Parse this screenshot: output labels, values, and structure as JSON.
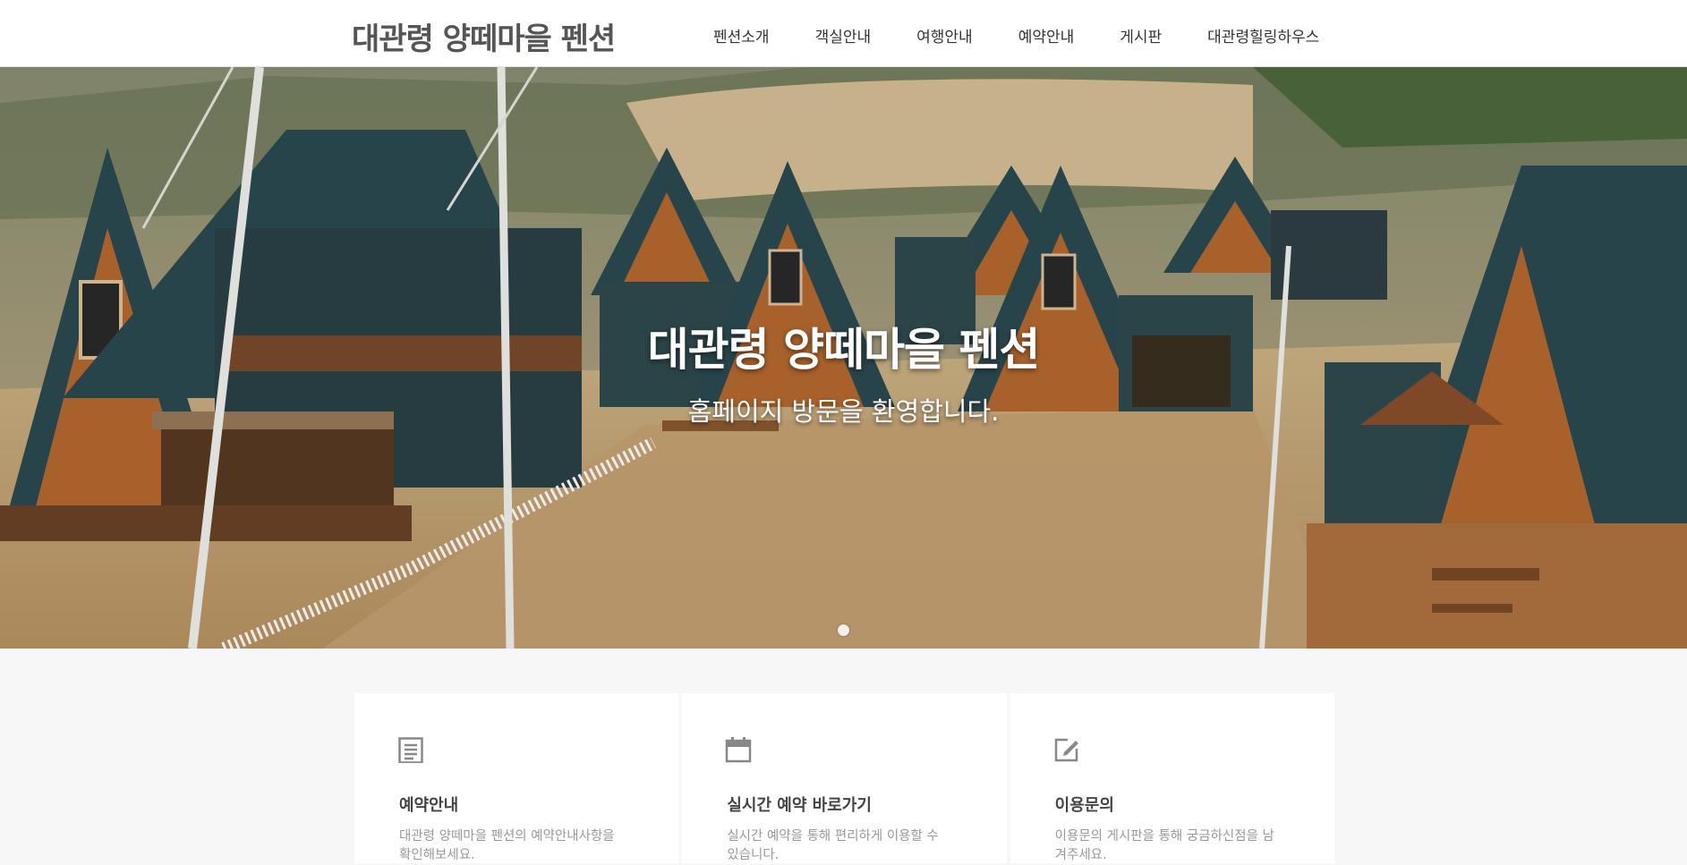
{
  "header": {
    "logo": "대관령 양떼마을 펜션",
    "nav": [
      "펜션소개",
      "객실안내",
      "여행안내",
      "예약안내",
      "게시판",
      "대관령힐링하우스"
    ]
  },
  "hero": {
    "title": "대관령 양떼마을 펜션",
    "subtitle": "홈페이지 방문을 환영합니다."
  },
  "cards": [
    {
      "icon": "document-icon",
      "title": "예약안내",
      "desc": "대관령 양떼마을 펜션의 예약안내사항을 확인해보세요."
    },
    {
      "icon": "calendar-icon",
      "title": "실시간 예약 바로가기",
      "desc": "실시간 예약을 통해 편리하게 이용할 수 있습니다."
    },
    {
      "icon": "edit-icon",
      "title": "이용문의",
      "desc": "이용문의 게시판을 통해 궁금하신점을 남겨주세요."
    }
  ],
  "colors": {
    "roof": "#2c4a52",
    "wood": "#b86a30",
    "ground": "#c9a878",
    "icon": "#888888"
  }
}
